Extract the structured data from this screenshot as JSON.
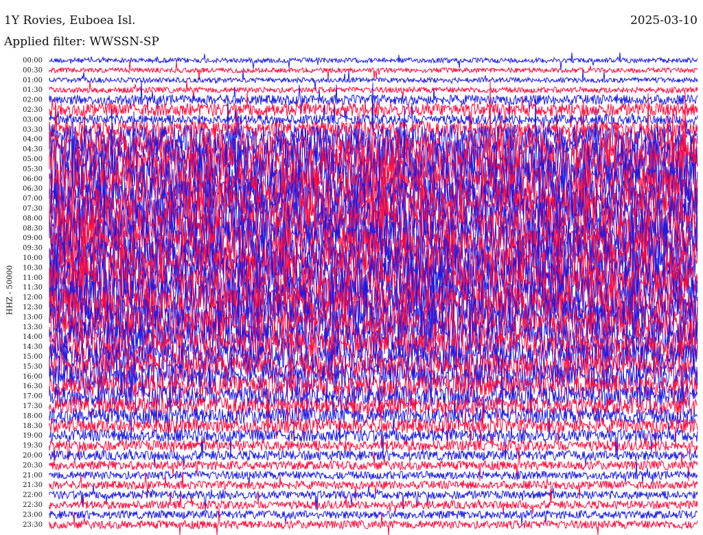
{
  "header": {
    "station": "1Y Rovies, Euboea Isl.",
    "date": "2025-03-10",
    "filter": "Applied filter: WWSSN-SP"
  },
  "chart_data": {
    "type": "line",
    "title": "1Y Rovies, Euboea Isl.",
    "ylabel": "HHZ - 50000",
    "row_labels": [
      "00:00",
      "00:30",
      "01:00",
      "01:30",
      "02:00",
      "02:30",
      "03:00",
      "03:30",
      "04:00",
      "04:30",
      "05:00",
      "05:30",
      "06:00",
      "06:30",
      "07:00",
      "07:30",
      "08:00",
      "08:30",
      "09:00",
      "09:30",
      "10:00",
      "10:30",
      "11:00",
      "11:30",
      "12:00",
      "12:30",
      "13:00",
      "13:30",
      "14:00",
      "14:30",
      "15:00",
      "15:30",
      "16:00",
      "16:30",
      "17:00",
      "17:30",
      "18:00",
      "18:30",
      "19:00",
      "19:30",
      "20:00",
      "20:30",
      "21:00",
      "21:30",
      "22:00",
      "22:30",
      "23:00",
      "23:30"
    ],
    "trace_colors": [
      "#1a1ae6",
      "#ff0a3c"
    ],
    "noise_level": [
      0.6,
      0.6,
      0.6,
      0.7,
      1.2,
      1.6,
      1.2,
      2.0,
      3.5,
      4.5,
      5,
      5,
      5,
      5,
      5,
      5,
      5,
      5,
      5,
      5,
      5,
      5,
      5,
      5,
      5,
      5,
      4.5,
      4,
      3.8,
      3.6,
      3.5,
      3.2,
      3.0,
      2.8,
      2.5,
      2.2,
      2.0,
      1.8,
      1.5,
      1.3,
      1.2,
      1.1,
      1.0,
      1.0,
      1.0,
      1.0,
      1.0,
      1.0
    ]
  }
}
